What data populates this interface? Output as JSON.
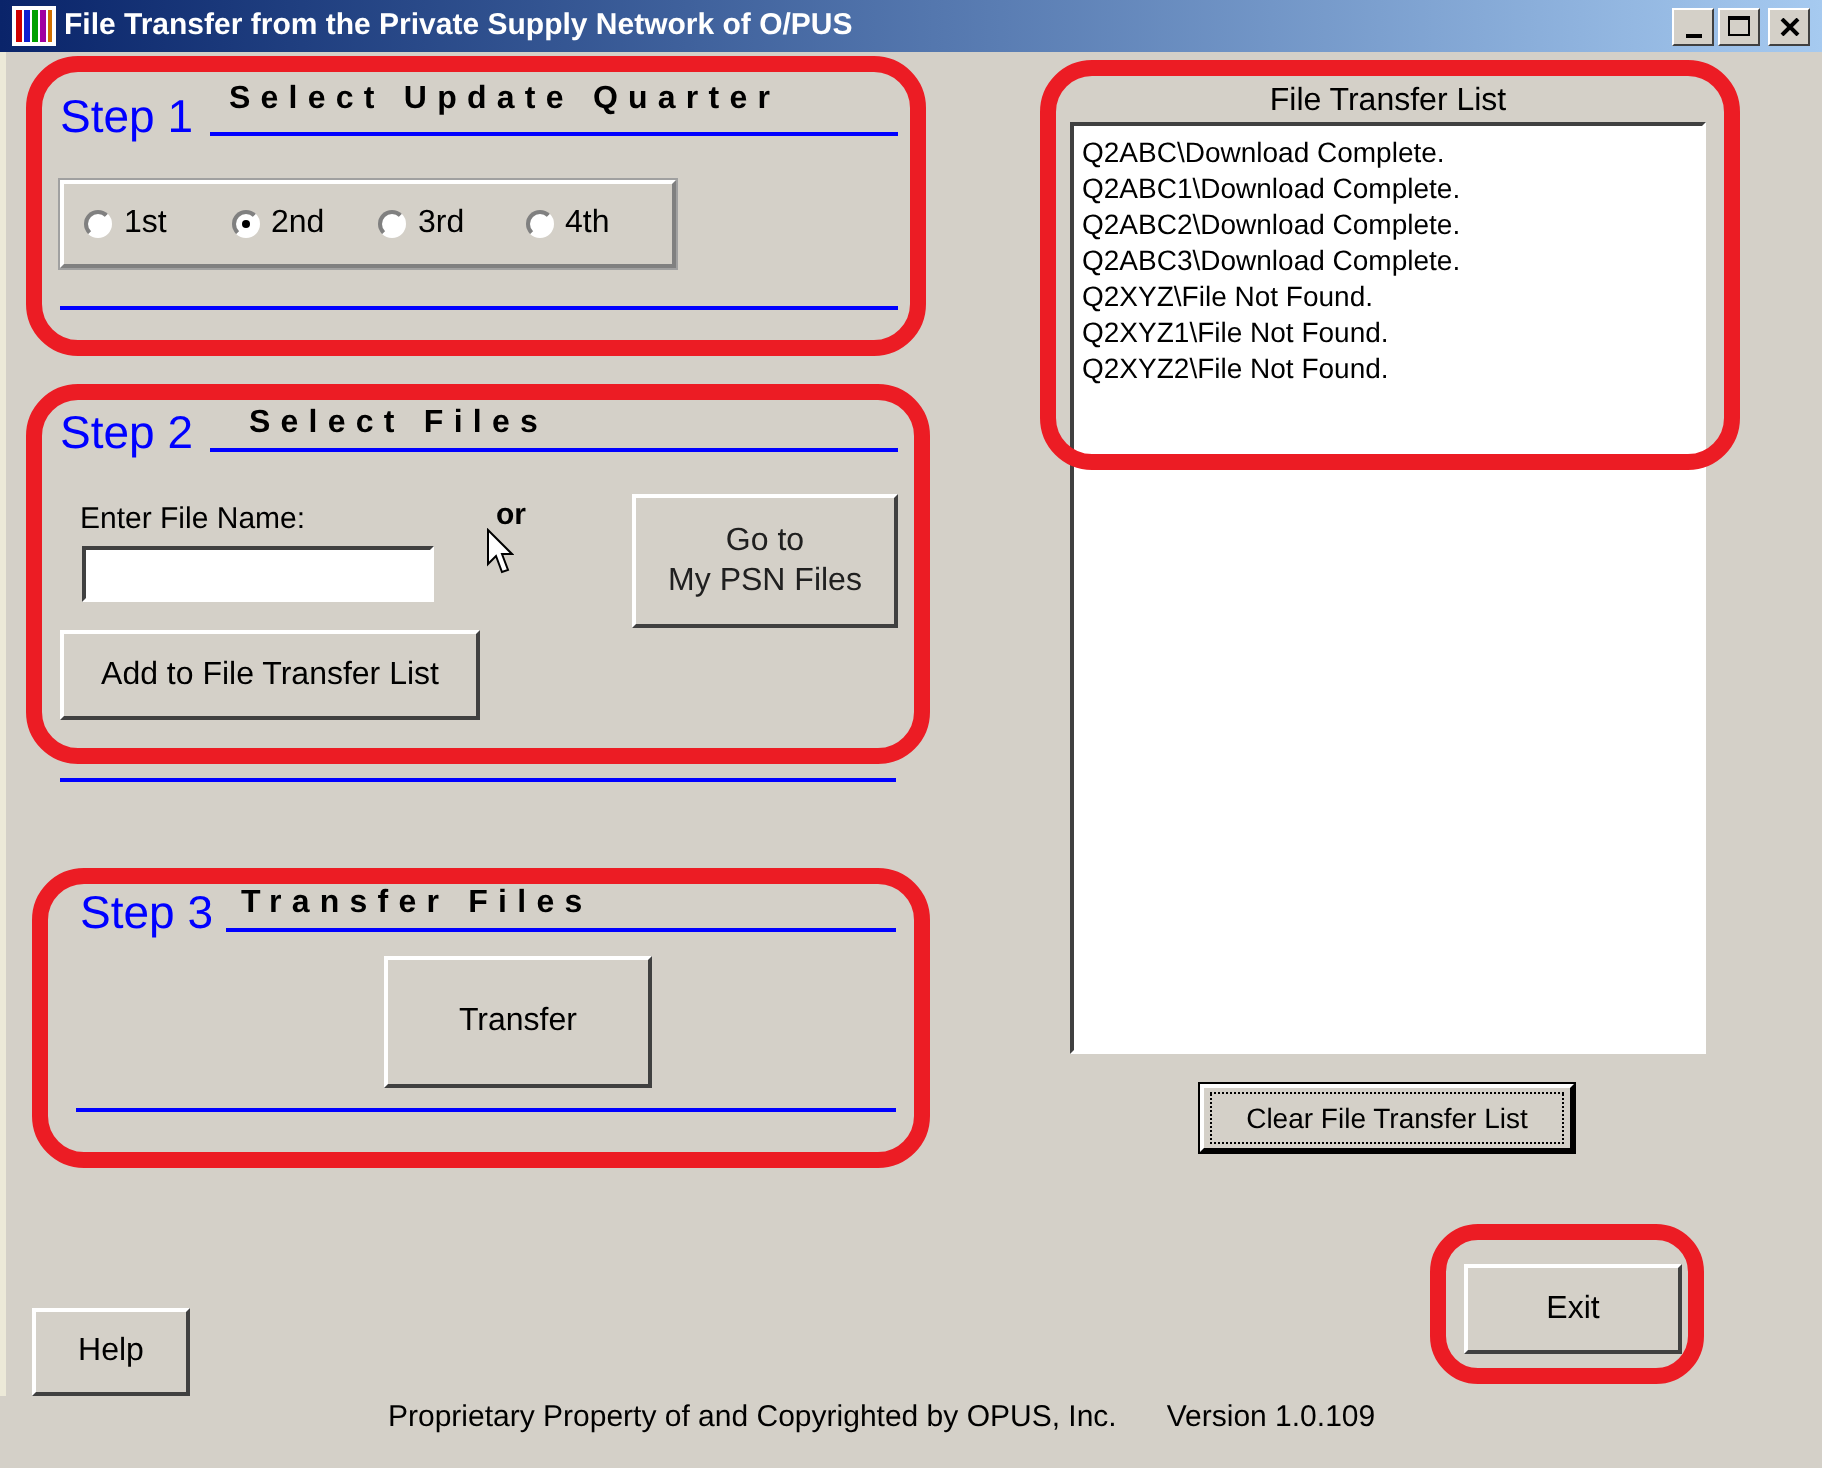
{
  "window": {
    "title": "File Transfer from the Private Supply Network of O/PUS"
  },
  "step1": {
    "label": "Step 1",
    "title": "Select Update Quarter",
    "highlighted": true,
    "quarters": [
      {
        "label": "1st",
        "selected": false
      },
      {
        "label": "2nd",
        "selected": true
      },
      {
        "label": "3rd",
        "selected": false
      },
      {
        "label": "4th",
        "selected": false
      }
    ]
  },
  "step2": {
    "label": "Step 2",
    "title": "Select Files",
    "highlighted": true,
    "file_name_label": "Enter File Name:",
    "or_text": "or",
    "browse_button": "Go to\nMy PSN Files",
    "add_button": "Add to File Transfer List"
  },
  "step3": {
    "label": "Step 3",
    "title": "Transfer Files",
    "highlighted": true,
    "transfer_button": "Transfer"
  },
  "file_list": {
    "title": "File Transfer List",
    "highlighted": true,
    "items": [
      "Q2ABC\\Download Complete.",
      "Q2ABC1\\Download Complete.",
      "Q2ABC2\\Download Complete.",
      "Q2ABC3\\Download Complete.",
      "Q2XYZ\\File Not Found.",
      "Q2XYZ1\\File Not Found.",
      "Q2XYZ2\\File Not Found."
    ],
    "clear_button": {
      "label": "Clear File Transfer List",
      "focused": true
    }
  },
  "exit_button": {
    "label": "Exit",
    "highlighted": true
  },
  "help_button": "Help",
  "footer": {
    "copyright": "Proprietary Property of and Copyrighted by OPUS, Inc.",
    "version": "Version 1.0.109"
  }
}
